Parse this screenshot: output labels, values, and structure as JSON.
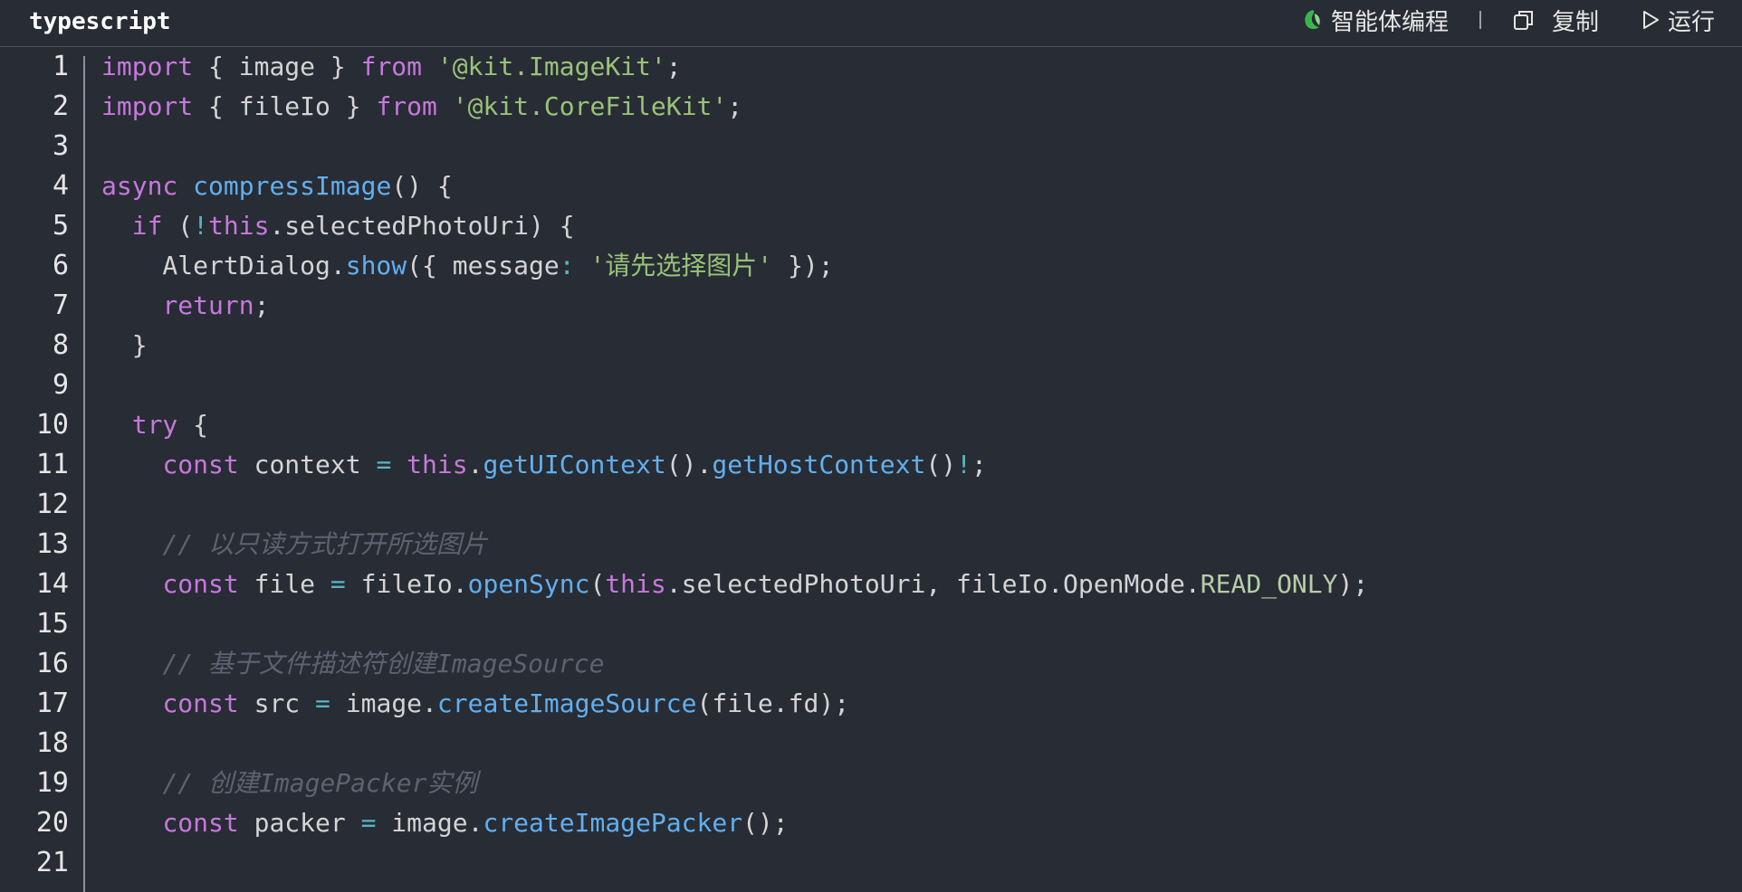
{
  "header": {
    "language": "typescript",
    "actions": {
      "agent_label": "智能体编程",
      "copy_label": "复制",
      "run_label": "运行"
    }
  },
  "colors": {
    "background": "#282c34",
    "keyword": "#c678dd",
    "string": "#98c379",
    "function": "#61afef",
    "comment": "#5c6370",
    "agent_icon": "#3bb54a"
  },
  "code": {
    "lines": [
      {
        "num": "1",
        "tokens": [
          [
            "kw",
            "import"
          ],
          [
            "pl",
            " { image } "
          ],
          [
            "kw",
            "from"
          ],
          [
            "pl",
            " "
          ],
          [
            "str",
            "'@kit.ImageKit'"
          ],
          [
            "pl",
            ";"
          ]
        ]
      },
      {
        "num": "2",
        "tokens": [
          [
            "kw",
            "import"
          ],
          [
            "pl",
            " { fileIo } "
          ],
          [
            "kw",
            "from"
          ],
          [
            "pl",
            " "
          ],
          [
            "str",
            "'@kit.CoreFileKit'"
          ],
          [
            "pl",
            ";"
          ]
        ]
      },
      {
        "num": "3",
        "tokens": []
      },
      {
        "num": "4",
        "tokens": [
          [
            "kw",
            "async"
          ],
          [
            "pl",
            " "
          ],
          [
            "fn",
            "compressImage"
          ],
          [
            "pl",
            "() {"
          ]
        ]
      },
      {
        "num": "5",
        "tokens": [
          [
            "pl",
            "  "
          ],
          [
            "kw",
            "if"
          ],
          [
            "pl",
            " ("
          ],
          [
            "op",
            "!"
          ],
          [
            "kw",
            "this"
          ],
          [
            "pl",
            ".selectedPhotoUri) {"
          ]
        ]
      },
      {
        "num": "6",
        "tokens": [
          [
            "pl",
            "    AlertDialog."
          ],
          [
            "fn",
            "show"
          ],
          [
            "pl",
            "({ message"
          ],
          [
            "op",
            ":"
          ],
          [
            "pl",
            " "
          ],
          [
            "str",
            "'请先选择图片'"
          ],
          [
            "pl",
            " });"
          ]
        ]
      },
      {
        "num": "7",
        "tokens": [
          [
            "pl",
            "    "
          ],
          [
            "kw",
            "return"
          ],
          [
            "pl",
            ";"
          ]
        ]
      },
      {
        "num": "8",
        "tokens": [
          [
            "pl",
            "  }"
          ]
        ]
      },
      {
        "num": "9",
        "tokens": []
      },
      {
        "num": "10",
        "tokens": [
          [
            "pl",
            "  "
          ],
          [
            "kw",
            "try"
          ],
          [
            "pl",
            " {"
          ]
        ]
      },
      {
        "num": "11",
        "tokens": [
          [
            "pl",
            "    "
          ],
          [
            "kw",
            "const"
          ],
          [
            "pl",
            " context "
          ],
          [
            "op",
            "="
          ],
          [
            "pl",
            " "
          ],
          [
            "kw",
            "this"
          ],
          [
            "pl",
            "."
          ],
          [
            "fn",
            "getUIContext"
          ],
          [
            "pl",
            "()."
          ],
          [
            "fn",
            "getHostContext"
          ],
          [
            "pl",
            "()"
          ],
          [
            "op",
            "!"
          ],
          [
            "pl",
            ";"
          ]
        ]
      },
      {
        "num": "12",
        "tokens": []
      },
      {
        "num": "13",
        "tokens": [
          [
            "pl",
            "    "
          ],
          [
            "cm",
            "// 以只读方式打开所选图片"
          ]
        ]
      },
      {
        "num": "14",
        "tokens": [
          [
            "pl",
            "    "
          ],
          [
            "kw",
            "const"
          ],
          [
            "pl",
            " file "
          ],
          [
            "op",
            "="
          ],
          [
            "pl",
            " fileIo."
          ],
          [
            "fn",
            "openSync"
          ],
          [
            "pl",
            "("
          ],
          [
            "kw",
            "this"
          ],
          [
            "pl",
            ".selectedPhotoUri, fileIo.OpenMode."
          ],
          [
            "con",
            "READ_ONLY"
          ],
          [
            "pl",
            ");"
          ]
        ]
      },
      {
        "num": "15",
        "tokens": []
      },
      {
        "num": "16",
        "tokens": [
          [
            "pl",
            "    "
          ],
          [
            "cm",
            "// 基于文件描述符创建ImageSource"
          ]
        ]
      },
      {
        "num": "17",
        "tokens": [
          [
            "pl",
            "    "
          ],
          [
            "kw",
            "const"
          ],
          [
            "pl",
            " src "
          ],
          [
            "op",
            "="
          ],
          [
            "pl",
            " image."
          ],
          [
            "fn",
            "createImageSource"
          ],
          [
            "pl",
            "(file.fd);"
          ]
        ]
      },
      {
        "num": "18",
        "tokens": []
      },
      {
        "num": "19",
        "tokens": [
          [
            "pl",
            "    "
          ],
          [
            "cm",
            "// 创建ImagePacker实例"
          ]
        ]
      },
      {
        "num": "20",
        "tokens": [
          [
            "pl",
            "    "
          ],
          [
            "kw",
            "const"
          ],
          [
            "pl",
            " packer "
          ],
          [
            "op",
            "="
          ],
          [
            "pl",
            " image."
          ],
          [
            "fn",
            "createImagePacker"
          ],
          [
            "pl",
            "();"
          ]
        ]
      },
      {
        "num": "21",
        "tokens": []
      }
    ]
  }
}
